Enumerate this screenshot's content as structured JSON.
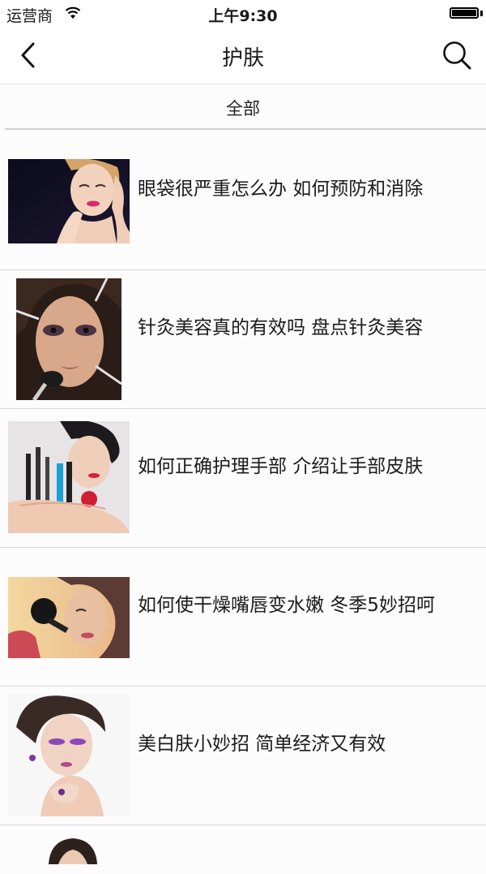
{
  "status_bar": {
    "carrier": "运营商",
    "time": "上午9:30"
  },
  "nav": {
    "title": "护肤",
    "back_icon": "chevron-left-icon",
    "search_icon": "search-icon"
  },
  "category": {
    "label": "全部"
  },
  "articles": [
    {
      "title": "眼袋很严重怎么办 如何预防和消除"
    },
    {
      "title": "针灸美容真的有效吗 盘点针灸美容"
    },
    {
      "title": "如何正确护理手部 介绍让手部皮肤"
    },
    {
      "title": "如何使干燥嘴唇变水嫩 冬季5妙招呵"
    },
    {
      "title": "美白肤小妙招 简单经济又有效"
    }
  ]
}
